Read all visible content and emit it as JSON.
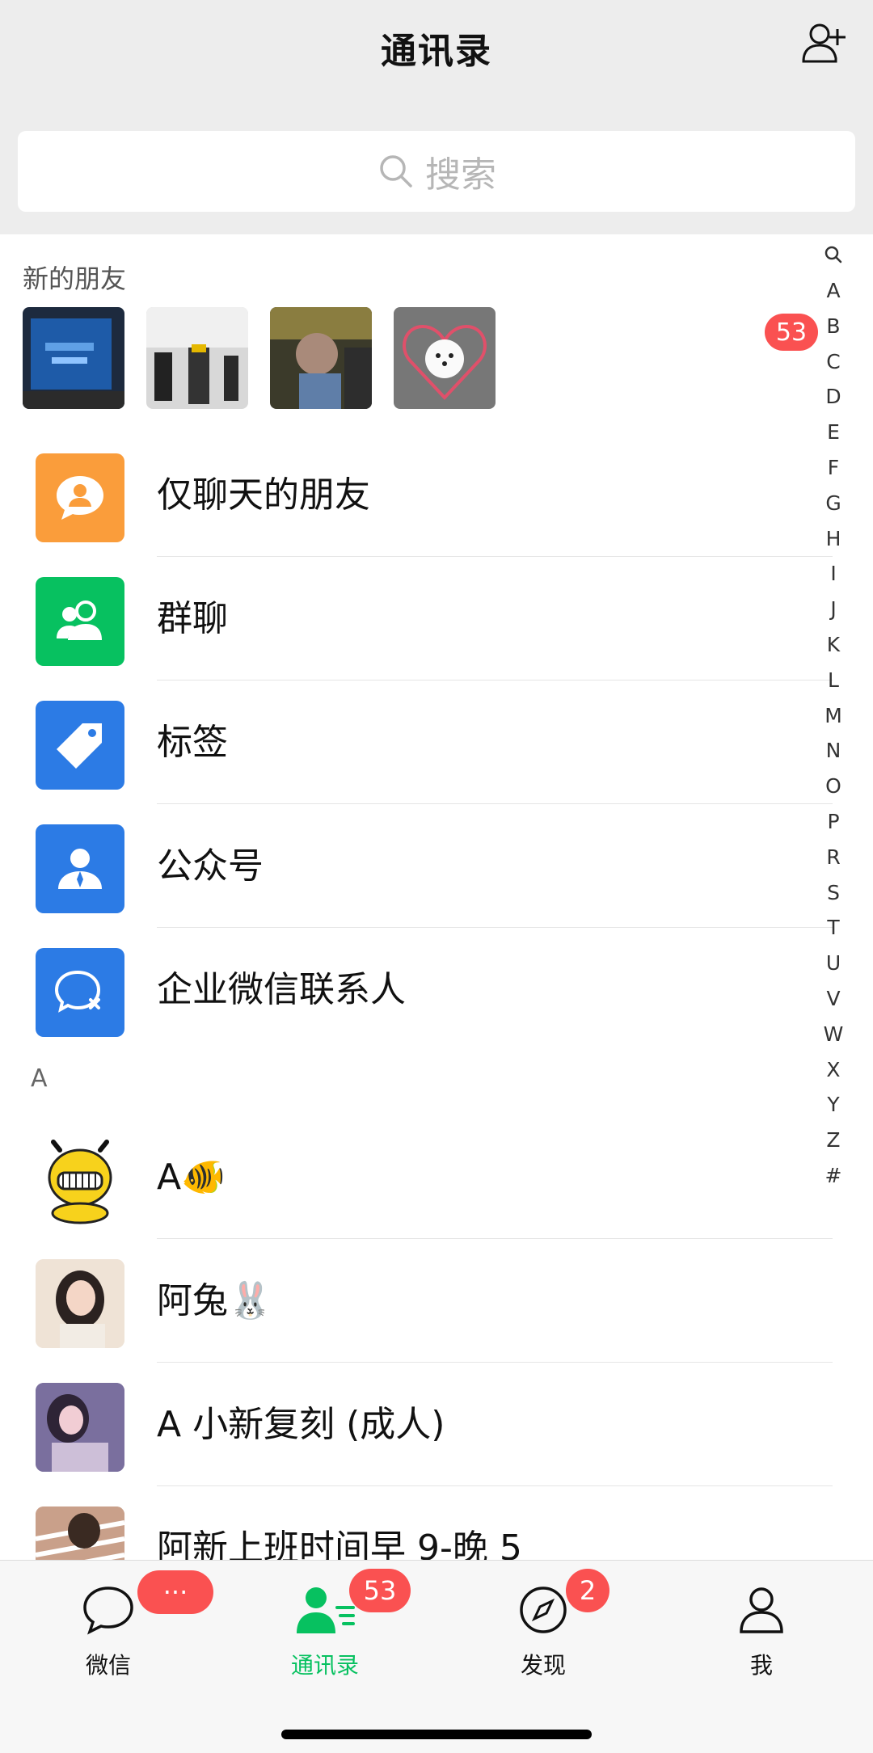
{
  "header": {
    "title": "通讯录"
  },
  "search": {
    "placeholder": "搜索"
  },
  "new_friends": {
    "title": "新的朋友",
    "badge": "53"
  },
  "menu": [
    {
      "label": "仅聊天的朋友",
      "color": "#fa9d3b",
      "icon": "chat-person-icon"
    },
    {
      "label": "群聊",
      "color": "#07c160",
      "icon": "group-icon"
    },
    {
      "label": "标签",
      "color": "#2c7be5",
      "icon": "tag-icon"
    },
    {
      "label": "公众号",
      "color": "#2c7be5",
      "icon": "official-account-icon"
    },
    {
      "label": "企业微信联系人",
      "color": "#2c7be5",
      "icon": "enterprise-wechat-icon"
    }
  ],
  "section_a": "A",
  "contacts": [
    {
      "name": "A🐠"
    },
    {
      "name": "阿兔🐰"
    },
    {
      "name": "A 小新复刻 (成人)"
    },
    {
      "name": "阿新上班时间早 9-晚 5"
    }
  ],
  "index_letters": [
    "A",
    "B",
    "C",
    "D",
    "E",
    "F",
    "G",
    "H",
    "I",
    "J",
    "K",
    "L",
    "M",
    "N",
    "O",
    "P",
    "R",
    "S",
    "T",
    "U",
    "V",
    "W",
    "X",
    "Y",
    "Z",
    "#"
  ],
  "tabs": [
    {
      "label": "微信",
      "badge": "···"
    },
    {
      "label": "通讯录",
      "badge": "53"
    },
    {
      "label": "发现",
      "badge": "2"
    },
    {
      "label": "我",
      "badge": ""
    }
  ],
  "colors": {
    "accent_green": "#07c160",
    "badge_red": "#fa5151"
  }
}
